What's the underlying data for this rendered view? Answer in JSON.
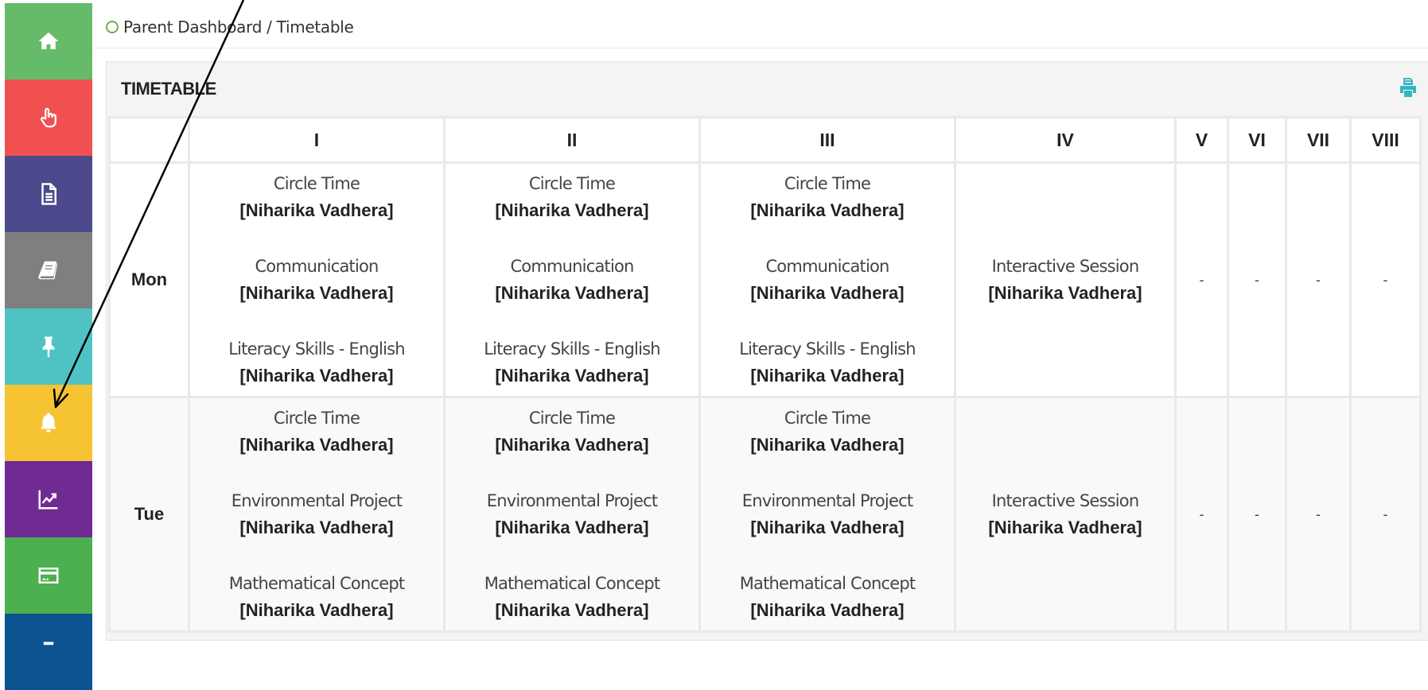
{
  "sidebar": {
    "items": [
      {
        "icon": "home-icon",
        "color": "#66bb6a"
      },
      {
        "icon": "hand-pointer-icon",
        "color": "#f05050"
      },
      {
        "icon": "document-icon",
        "color": "#4c4a8c"
      },
      {
        "icon": "book-icon",
        "color": "#7f7f7f"
      },
      {
        "icon": "pin-icon",
        "color": "#4fc3c4"
      },
      {
        "icon": "bell-icon",
        "color": "#f6c333"
      },
      {
        "icon": "line-chart-icon",
        "color": "#6f2b92"
      },
      {
        "icon": "credit-card-icon",
        "color": "#4caf50"
      },
      {
        "icon": "more-icon",
        "color": "#0d5392"
      }
    ]
  },
  "breadcrumb": {
    "text": "Parent Dashboard / Timetable"
  },
  "panel": {
    "title": "TIMETABLE",
    "print_icon": "print-icon"
  },
  "timetable": {
    "headers": [
      "",
      "I",
      "II",
      "III",
      "IV",
      "V",
      "VI",
      "VII",
      "VIII"
    ],
    "rows": [
      {
        "day": "Mon",
        "periods": [
          [
            {
              "subject": "Circle Time",
              "teacher": "[Niharika Vadhera]"
            },
            {
              "subject": "Communication",
              "teacher": "[Niharika Vadhera]"
            },
            {
              "subject": "Literacy Skills - English",
              "teacher": "[Niharika Vadhera]"
            }
          ],
          [
            {
              "subject": "Circle Time",
              "teacher": "[Niharika Vadhera]"
            },
            {
              "subject": "Communication",
              "teacher": "[Niharika Vadhera]"
            },
            {
              "subject": "Literacy Skills - English",
              "teacher": "[Niharika Vadhera]"
            }
          ],
          [
            {
              "subject": "Circle Time",
              "teacher": "[Niharika Vadhera]"
            },
            {
              "subject": "Communication",
              "teacher": "[Niharika Vadhera]"
            },
            {
              "subject": "Literacy Skills - English",
              "teacher": "[Niharika Vadhera]"
            }
          ],
          [
            {
              "subject": "Interactive Session",
              "teacher": "[Niharika Vadhera]"
            }
          ]
        ],
        "empty": [
          "-",
          "-",
          "-",
          "-"
        ]
      },
      {
        "day": "Tue",
        "periods": [
          [
            {
              "subject": "Circle Time",
              "teacher": "[Niharika Vadhera]"
            },
            {
              "subject": "Environmental Project",
              "teacher": "[Niharika Vadhera]"
            },
            {
              "subject": "Mathematical Concept",
              "teacher": "[Niharika Vadhera]"
            }
          ],
          [
            {
              "subject": "Circle Time",
              "teacher": "[Niharika Vadhera]"
            },
            {
              "subject": "Environmental Project",
              "teacher": "[Niharika Vadhera]"
            },
            {
              "subject": "Mathematical Concept",
              "teacher": "[Niharika Vadhera]"
            }
          ],
          [
            {
              "subject": "Circle Time",
              "teacher": "[Niharika Vadhera]"
            },
            {
              "subject": "Environmental Project",
              "teacher": "[Niharika Vadhera]"
            },
            {
              "subject": "Mathematical Concept",
              "teacher": "[Niharika Vadhera]"
            }
          ],
          [
            {
              "subject": "Interactive Session",
              "teacher": "[Niharika Vadhera]"
            }
          ]
        ],
        "empty": [
          "-",
          "-",
          "-",
          "-"
        ]
      }
    ]
  },
  "annotation": {
    "arrow_target": "bell-icon"
  }
}
